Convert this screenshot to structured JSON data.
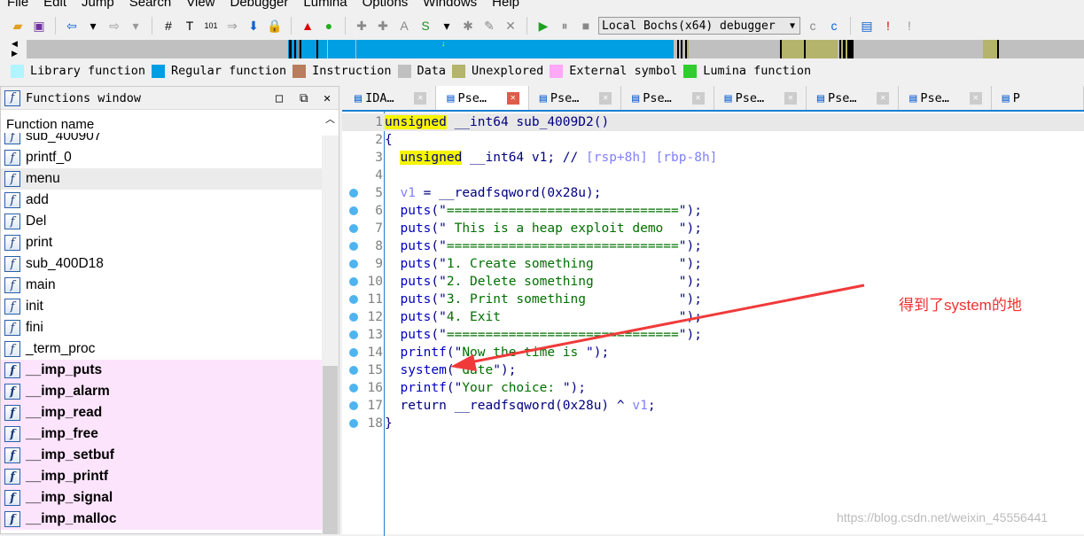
{
  "menu": [
    "File",
    "Edit",
    "Jump",
    "Search",
    "View",
    "Debugger",
    "Lumina",
    "Options",
    "Windows",
    "Help"
  ],
  "debugger_select": "Local Bochs(x64) debugger",
  "legend": [
    {
      "label": "Library function",
      "color": "#b0f4ff"
    },
    {
      "label": "Regular function",
      "color": "#009ee2"
    },
    {
      "label": "Instruction",
      "color": "#b87c5e"
    },
    {
      "label": "Data",
      "color": "#c0c0c0"
    },
    {
      "label": "Unexplored",
      "color": "#b4b46c"
    },
    {
      "label": "External symbol",
      "color": "#ffa8f8"
    },
    {
      "label": "Lumina function",
      "color": "#30cc30"
    }
  ],
  "functions_window": {
    "title": "Functions window",
    "column": "Function name",
    "items": [
      {
        "name": "sub_400907",
        "type": "regular"
      },
      {
        "name": "printf_0",
        "type": "regular"
      },
      {
        "name": "menu",
        "type": "selected"
      },
      {
        "name": "add",
        "type": "regular"
      },
      {
        "name": "Del",
        "type": "regular"
      },
      {
        "name": "print",
        "type": "regular"
      },
      {
        "name": "sub_400D18",
        "type": "regular"
      },
      {
        "name": "main",
        "type": "regular"
      },
      {
        "name": "init",
        "type": "regular"
      },
      {
        "name": "fini",
        "type": "regular"
      },
      {
        "name": "_term_proc",
        "type": "regular"
      },
      {
        "name": "__imp_puts",
        "type": "imp"
      },
      {
        "name": "__imp_alarm",
        "type": "imp"
      },
      {
        "name": "__imp_read",
        "type": "imp"
      },
      {
        "name": "__imp_free",
        "type": "imp"
      },
      {
        "name": "__imp_setbuf",
        "type": "imp"
      },
      {
        "name": "__imp_printf",
        "type": "imp"
      },
      {
        "name": "__imp_signal",
        "type": "imp"
      },
      {
        "name": "__imp_malloc",
        "type": "imp"
      }
    ]
  },
  "tabs": [
    {
      "label": "IDA…",
      "active": false
    },
    {
      "label": "Pse…",
      "active": true
    },
    {
      "label": "Pse…",
      "active": false
    },
    {
      "label": "Pse…",
      "active": false
    },
    {
      "label": "Pse…",
      "active": false
    },
    {
      "label": "Pse…",
      "active": false
    },
    {
      "label": "Pse…",
      "active": false
    },
    {
      "label": "P",
      "active": false
    }
  ],
  "code": [
    {
      "n": "1",
      "bp": false,
      "t": [
        [
          "kw",
          "unsigned"
        ],
        [
          "pl",
          " __int64 sub_4009D2()"
        ]
      ]
    },
    {
      "n": "2",
      "bp": false,
      "t": [
        [
          "pl",
          "{"
        ]
      ]
    },
    {
      "n": "3",
      "bp": false,
      "t": [
        [
          "pl",
          "  "
        ],
        [
          "kw",
          "unsigned"
        ],
        [
          "pl",
          " __int64 v1; // "
        ],
        [
          "cm",
          "[rsp+8h] [rbp-8h]"
        ]
      ]
    },
    {
      "n": "4",
      "bp": false,
      "t": []
    },
    {
      "n": "5",
      "bp": true,
      "t": [
        [
          "pl",
          "  "
        ],
        [
          "var",
          "v1"
        ],
        [
          "pl",
          " = __readfsqword(0x28u);"
        ]
      ]
    },
    {
      "n": "6",
      "bp": true,
      "t": [
        [
          "fn",
          "  puts"
        ],
        [
          "pl",
          "(\""
        ],
        [
          "str",
          "=============================="
        ],
        [
          "pl",
          "\");"
        ]
      ]
    },
    {
      "n": "7",
      "bp": true,
      "t": [
        [
          "fn",
          "  puts"
        ],
        [
          "pl",
          "(\""
        ],
        [
          "str",
          " This is a heap exploit demo  "
        ],
        [
          "pl",
          "\");"
        ]
      ]
    },
    {
      "n": "8",
      "bp": true,
      "t": [
        [
          "fn",
          "  puts"
        ],
        [
          "pl",
          "(\""
        ],
        [
          "str",
          "=============================="
        ],
        [
          "pl",
          "\");"
        ]
      ]
    },
    {
      "n": "9",
      "bp": true,
      "t": [
        [
          "fn",
          "  puts"
        ],
        [
          "pl",
          "(\""
        ],
        [
          "str",
          "1. Create something           "
        ],
        [
          "pl",
          "\");"
        ]
      ]
    },
    {
      "n": "10",
      "bp": true,
      "t": [
        [
          "fn",
          "  puts"
        ],
        [
          "pl",
          "(\""
        ],
        [
          "str",
          "2. Delete something           "
        ],
        [
          "pl",
          "\");"
        ]
      ]
    },
    {
      "n": "11",
      "bp": true,
      "t": [
        [
          "fn",
          "  puts"
        ],
        [
          "pl",
          "(\""
        ],
        [
          "str",
          "3. Print something            "
        ],
        [
          "pl",
          "\");"
        ]
      ]
    },
    {
      "n": "12",
      "bp": true,
      "t": [
        [
          "fn",
          "  puts"
        ],
        [
          "pl",
          "(\""
        ],
        [
          "str",
          "4. Exit                       "
        ],
        [
          "pl",
          "\");"
        ]
      ]
    },
    {
      "n": "13",
      "bp": true,
      "t": [
        [
          "fn",
          "  puts"
        ],
        [
          "pl",
          "(\""
        ],
        [
          "str",
          "=============================="
        ],
        [
          "pl",
          "\");"
        ]
      ]
    },
    {
      "n": "14",
      "bp": true,
      "t": [
        [
          "fn",
          "  printf"
        ],
        [
          "pl",
          "(\""
        ],
        [
          "str",
          "Now the time is "
        ],
        [
          "pl",
          "\");"
        ]
      ]
    },
    {
      "n": "15",
      "bp": true,
      "t": [
        [
          "fn",
          "  system"
        ],
        [
          "pl",
          "(\""
        ],
        [
          "str",
          "date"
        ],
        [
          "pl",
          "\");"
        ]
      ]
    },
    {
      "n": "16",
      "bp": true,
      "t": [
        [
          "fn",
          "  printf"
        ],
        [
          "pl",
          "(\""
        ],
        [
          "str",
          "Your choice: "
        ],
        [
          "pl",
          "\");"
        ]
      ]
    },
    {
      "n": "17",
      "bp": true,
      "t": [
        [
          "pl",
          "  return __readfsqword(0x28u) ^ "
        ],
        [
          "var",
          "v1"
        ],
        [
          "pl",
          ";"
        ]
      ]
    },
    {
      "n": "18",
      "bp": true,
      "t": [
        [
          "pl",
          "}"
        ]
      ]
    }
  ],
  "annotation": "得到了system的地",
  "watermark": "https://blog.csdn.net/weixin_45556441"
}
